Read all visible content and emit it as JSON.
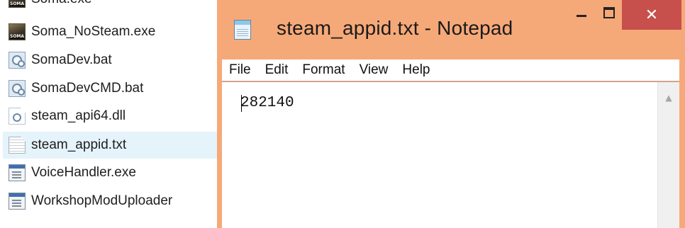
{
  "explorer": {
    "files": [
      {
        "name": "Soma.exe",
        "icon": "soma-exe-icon"
      },
      {
        "name": "Soma_NoSteam.exe",
        "icon": "soma-exe-icon"
      },
      {
        "name": "SomaDev.bat",
        "icon": "batch-file-icon"
      },
      {
        "name": "SomaDevCMD.bat",
        "icon": "batch-file-icon"
      },
      {
        "name": "steam_api64.dll",
        "icon": "dll-file-icon"
      },
      {
        "name": "steam_appid.txt",
        "icon": "text-file-icon",
        "selected": true
      },
      {
        "name": "VoiceHandler.exe",
        "icon": "exe-file-icon"
      },
      {
        "name": "WorkshopModUploader",
        "icon": "exe-file-icon"
      }
    ]
  },
  "notepad": {
    "title": "steam_appid.txt - Notepad",
    "buttons": {
      "minimize_icon": "minimize-icon",
      "maximize_icon": "maximize-icon",
      "close_glyph": "✕"
    },
    "menu": [
      "File",
      "Edit",
      "Format",
      "View",
      "Help"
    ],
    "content": "282140",
    "scroll_up_glyph": "▲"
  },
  "colors": {
    "title_bar": "#f6a978",
    "close_button": "#c74f4c",
    "selected_row": "#e5f3fb"
  }
}
